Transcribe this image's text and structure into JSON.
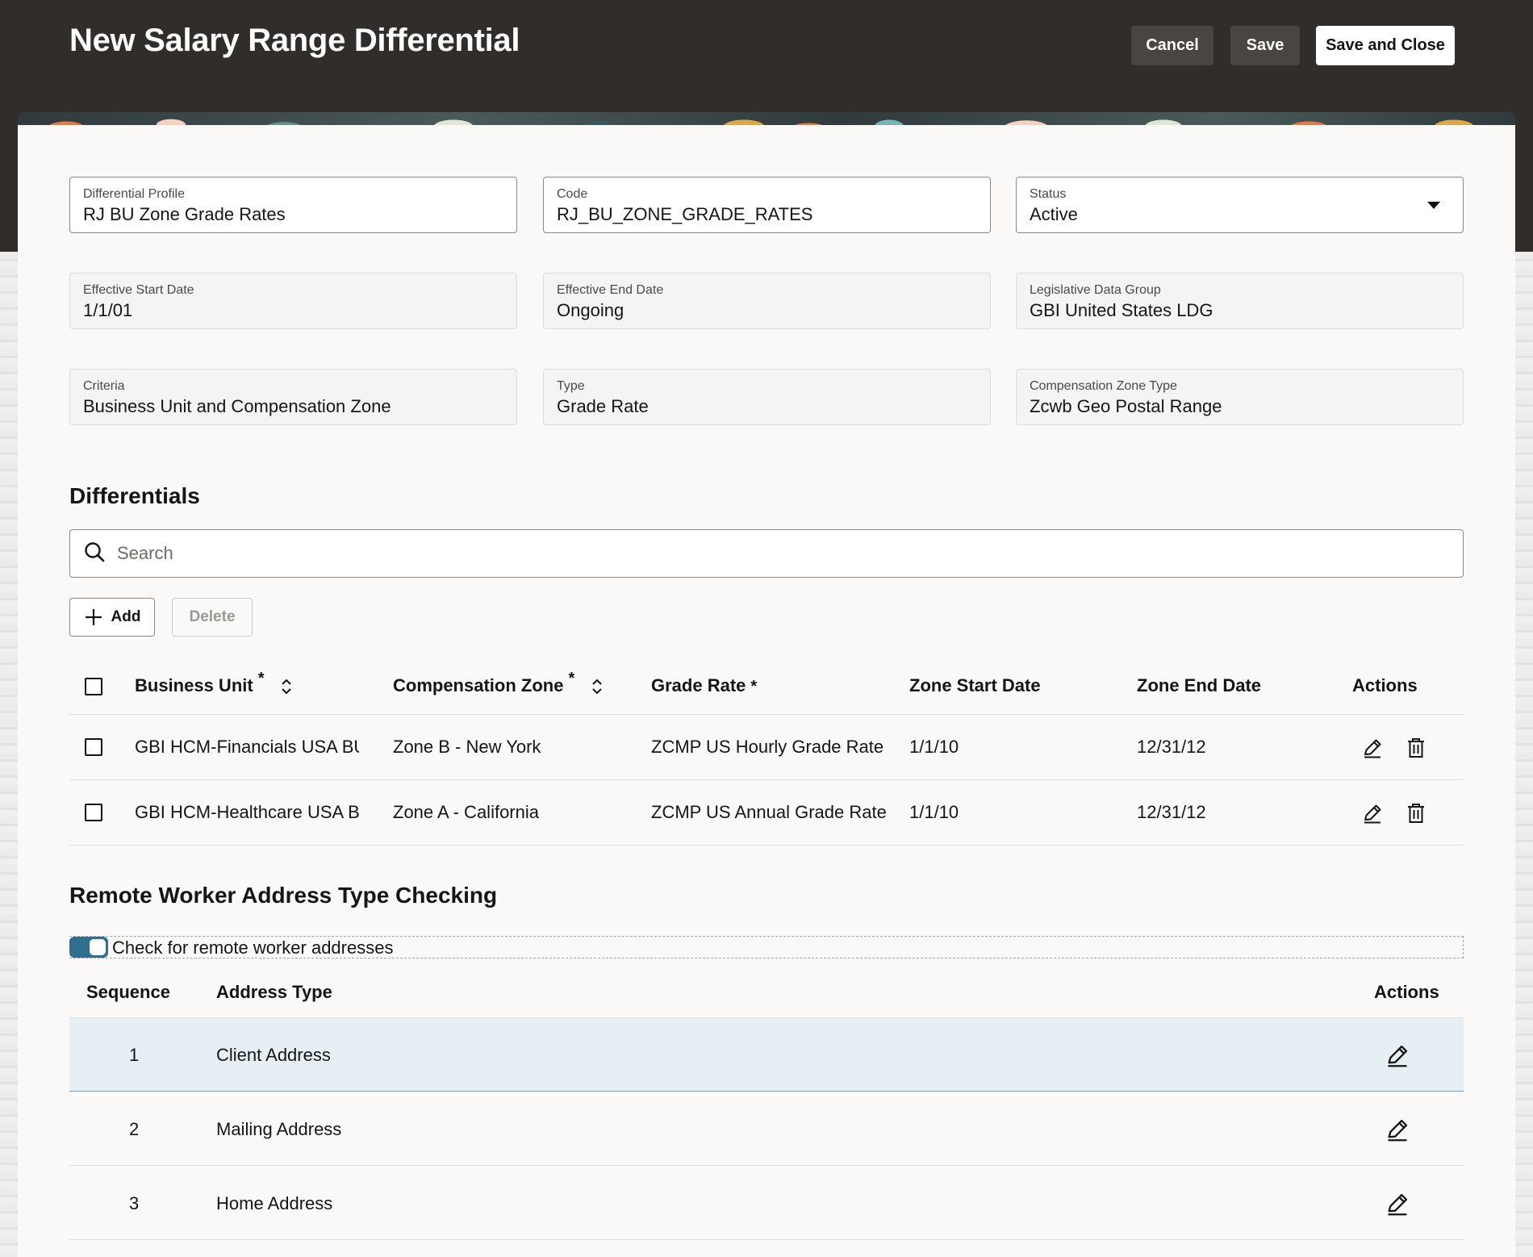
{
  "header": {
    "title": "New Salary Range Differential",
    "cancel_label": "Cancel",
    "save_label": "Save",
    "save_close_label": "Save and Close"
  },
  "form": {
    "differential_profile": {
      "label": "Differential Profile",
      "value": "RJ BU Zone Grade Rates"
    },
    "code": {
      "label": "Code",
      "value": "RJ_BU_ZONE_GRADE_RATES"
    },
    "status": {
      "label": "Status",
      "value": "Active"
    },
    "effective_start_date": {
      "label": "Effective Start Date",
      "value": "1/1/01"
    },
    "effective_end_date": {
      "label": "Effective End Date",
      "value": "Ongoing"
    },
    "legislative_data_group": {
      "label": "Legislative Data Group",
      "value": "GBI United States LDG"
    },
    "criteria": {
      "label": "Criteria",
      "value": "Business Unit and Compensation Zone"
    },
    "type": {
      "label": "Type",
      "value": "Grade Rate"
    },
    "compensation_zone_type": {
      "label": "Compensation Zone Type",
      "value": "Zcwb Geo Postal Range"
    }
  },
  "differentials": {
    "title": "Differentials",
    "search_placeholder": "Search",
    "add_label": "Add",
    "delete_label": "Delete",
    "required_mark": "*",
    "columns": {
      "business_unit": "Business Unit",
      "compensation_zone": "Compensation Zone",
      "grade_rate": "Grade Rate",
      "zone_start_date": "Zone Start Date",
      "zone_end_date": "Zone End Date",
      "actions": "Actions"
    },
    "rows": [
      {
        "business_unit": "GBI HCM-Financials USA BU",
        "compensation_zone": "Zone B - New York",
        "grade_rate": "ZCMP US Hourly Grade Rate",
        "zone_start_date": "1/1/10",
        "zone_end_date": "12/31/12"
      },
      {
        "business_unit": "GBI HCM-Healthcare USA BU",
        "compensation_zone": "Zone A - California",
        "grade_rate": "ZCMP US Annual Grade Rate",
        "zone_start_date": "1/1/10",
        "zone_end_date": "12/31/12"
      }
    ]
  },
  "remote_worker": {
    "title": "Remote Worker Address Type Checking",
    "toggle_label": "Check for remote worker addresses",
    "toggle_on": true,
    "columns": {
      "sequence": "Sequence",
      "address_type": "Address Type",
      "actions": "Actions"
    },
    "rows": [
      {
        "sequence": "1",
        "address_type": "Client Address"
      },
      {
        "sequence": "2",
        "address_type": "Mailing Address"
      },
      {
        "sequence": "3",
        "address_type": "Home Address"
      }
    ]
  },
  "icons": {
    "search": "search-icon",
    "add": "plus-icon",
    "sort": "sort-icon",
    "edit": "pencil-icon",
    "delete": "trash-icon",
    "dropdown": "chevron-down-icon"
  },
  "colors": {
    "header_bg": "#312d2a",
    "toggle_on": "#2f6f8f",
    "selected_row": "#e6eff4"
  }
}
